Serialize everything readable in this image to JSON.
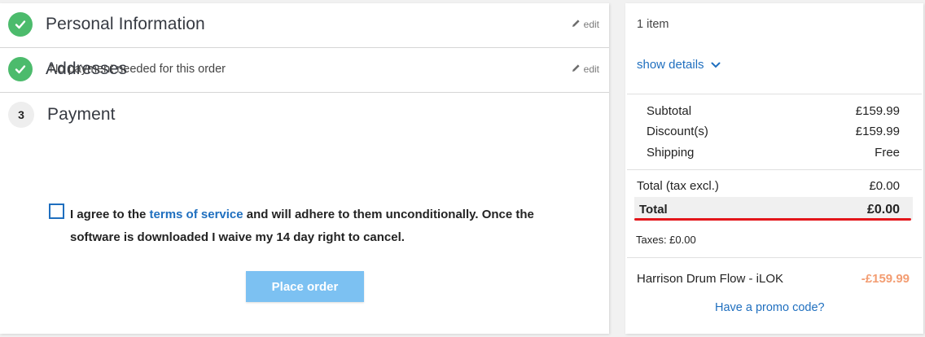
{
  "steps": [
    {
      "title": "Personal Information",
      "status": "complete",
      "edit_label": "edit"
    },
    {
      "title": "Addresses",
      "status": "complete",
      "edit_label": "edit"
    },
    {
      "number": "3",
      "title": "Payment",
      "status": "current"
    }
  ],
  "payment": {
    "message": "No payment needed for this order",
    "terms_prefix": "I agree to the ",
    "terms_link": "terms of service",
    "terms_suffix": " and will adhere to them unconditionally. Once the software is downloaded I waive my 14 day right to cancel.",
    "terms_checked": false,
    "place_order_label": "Place order"
  },
  "summary": {
    "items_count": "1 item",
    "show_details": "show details",
    "subtotal_label": "Subtotal",
    "subtotal_value": "£159.99",
    "discount_label": "Discount(s)",
    "discount_value": "£159.99",
    "shipping_label": "Shipping",
    "shipping_value": "Free",
    "total_excl_label": "Total (tax excl.)",
    "total_excl_value": "£0.00",
    "total_label": "Total",
    "total_value": "£0.00",
    "taxes": "Taxes: £0.00",
    "product_name": "Harrison Drum Flow - iLOK",
    "product_price": "-£159.99",
    "promo_link": "Have a promo code?"
  },
  "colors": {
    "accent": "#1f6fbf",
    "success": "#4cbb6c",
    "button": "#7cc1f2",
    "discount": "#f39d72",
    "highlight": "#e3161b"
  }
}
